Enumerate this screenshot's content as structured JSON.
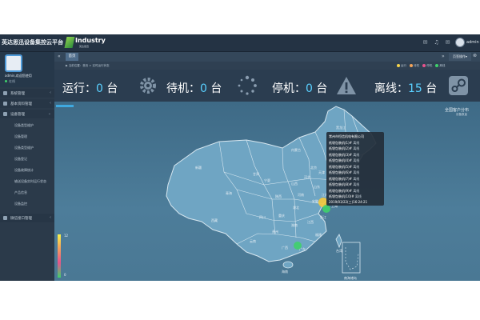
{
  "header": {
    "app_title": "英达思迅设备集控云平台",
    "logo_word": "Industry",
    "logo_sub": "英达思迅",
    "user_name": "admin",
    "icons": [
      "envelope-icon",
      "bell-icon",
      "mail-icon",
      "user-avatar"
    ]
  },
  "sidebar": {
    "user": {
      "name": "admin,欢迎您使用",
      "status": "在线"
    },
    "items": [
      {
        "label": "系统管理",
        "icon": "settings-icon",
        "arrow": "‹"
      },
      {
        "label": "基本资料管理",
        "icon": "list-icon",
        "arrow": "‹"
      },
      {
        "label": "设备管理",
        "icon": "device-icon",
        "arrow": "⌄"
      }
    ],
    "device_sub_items": [
      "设备类型维护",
      "设备管理",
      "设备类型维护",
      "设备登记",
      "设备故障统计",
      "输送设备实时运行状态",
      "产品信息",
      "设备监控"
    ],
    "wechat": {
      "label": "微信接口管理",
      "arrow": "‹"
    }
  },
  "tabs": {
    "home_label": "首页",
    "ops_label": "页签操作▾",
    "prev_arrow": "«",
    "next_arrow": "»",
    "close_glyph": "⊗"
  },
  "breadcrumb": {
    "text": "▶ 当前位置：首页 > 实时运行状态",
    "legend": [
      "运行",
      "待机",
      "停机",
      "离线"
    ],
    "legend_colors": [
      "#f6d44b",
      "#f4a45a",
      "#e7538c",
      "#3fd16b"
    ]
  },
  "status": [
    {
      "label": "运行：",
      "num": "0",
      "unit": " 台",
      "icon": "gear-icon"
    },
    {
      "label": "待机：",
      "num": "0",
      "unit": " 台",
      "icon": "loading-spinner-icon"
    },
    {
      "label": "停机：",
      "num": "0",
      "unit": " 台",
      "icon": "warning-icon"
    },
    {
      "label": "离线：",
      "num": "15",
      "unit": " 台",
      "icon": "steam-icon"
    }
  ],
  "map": {
    "title": "全国客户分布",
    "subtitle": "设备数量",
    "scale_max": "12",
    "scale_min": "0",
    "province_labels": [
      "黑龙江",
      "吉林",
      "辽宁",
      "内蒙古",
      "北京",
      "天津",
      "河北",
      "山西",
      "山东",
      "陕西",
      "宁夏",
      "甘肃",
      "青海",
      "新疆",
      "西藏",
      "四川",
      "重庆",
      "湖北",
      "河南",
      "安徽",
      "江苏",
      "上海",
      "浙江",
      "江西",
      "湖南",
      "贵州",
      "云南",
      "广西",
      "广东",
      "福建",
      "台湾",
      "海南",
      "南海诸岛"
    ],
    "markers": [
      {
        "name": "常州",
        "color": "#f6c93a"
      },
      {
        "name": "上海",
        "color": "#3fd16b"
      },
      {
        "name": "广州",
        "color": "#3fd16b"
      }
    ]
  },
  "tooltip": {
    "lines": [
      "常州市恒信机电有限公司",
      "纸袋包装机(1)#",
      "纸袋包装机(2)#",
      "纸袋包装机(3)#",
      "纸袋包装机(4)#",
      "纸袋包装机(5)#",
      "纸袋包装机(6)#",
      "纸袋包装机(7)#",
      "纸袋包装机(8)#",
      "纸袋包装机(9)#",
      "纸袋包装机(10)#",
      "2019/03/22(三)16:24:21"
    ],
    "status_word": "离线"
  }
}
